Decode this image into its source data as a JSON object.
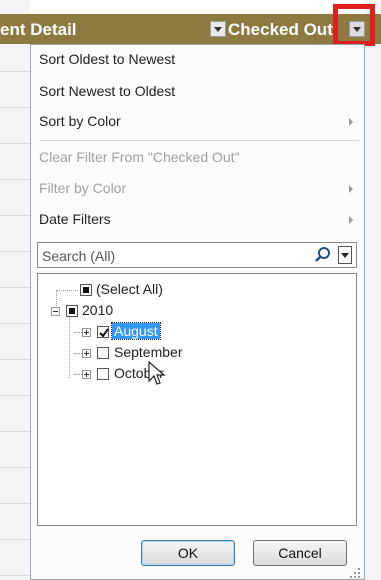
{
  "header": {
    "left_column": "ent Detail",
    "right_column": "Checked Out"
  },
  "menu": {
    "sort_oldest": "Sort Oldest to Newest",
    "sort_newest": "Sort Newest to Oldest",
    "sort_color": "Sort by Color",
    "clear_filter": "Clear Filter From \"Checked Out\"",
    "filter_color": "Filter by Color",
    "date_filters": "Date Filters"
  },
  "search": {
    "placeholder": "Search (All)"
  },
  "tree": {
    "select_all": "(Select All)",
    "year": "2010",
    "months": [
      "August",
      "September",
      "October"
    ]
  },
  "buttons": {
    "ok": "OK",
    "cancel": "Cancel"
  },
  "colors": {
    "header_bg": "#8c7a41",
    "highlight": "#e02020",
    "selection": "#3399ff"
  }
}
